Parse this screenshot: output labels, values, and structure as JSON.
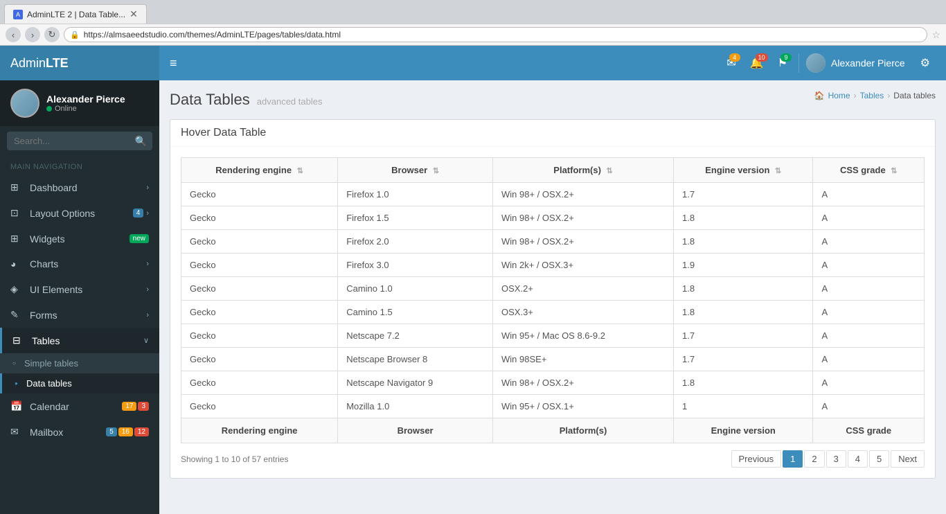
{
  "browser": {
    "tab_label": "AdminLTE 2 | Data Table...",
    "url": "https://almsaeedstudio.com/themes/AdminLTE/pages/tables/data.html",
    "favicon_text": "A"
  },
  "header": {
    "logo_light": "Admin",
    "logo_bold": "LTE",
    "toggle_icon": "≡",
    "notifications": [
      {
        "icon": "✉",
        "count": "4",
        "badge_color": "yellow"
      },
      {
        "icon": "🔔",
        "count": "10",
        "badge_color": "red"
      },
      {
        "icon": "⚑",
        "count": "9",
        "badge_color": "green"
      }
    ],
    "user_name": "Alexander Pierce",
    "gear_icon": "⚙"
  },
  "sidebar": {
    "user_name": "Alexander Pierce",
    "user_status": "Online",
    "search_placeholder": "Search...",
    "nav_label": "MAIN NAVIGATION",
    "items": [
      {
        "label": "Dashboard",
        "icon": "⊞",
        "has_arrow": true,
        "badge": null
      },
      {
        "label": "Layout Options",
        "icon": "⊡",
        "has_arrow": true,
        "badge": "4",
        "badge_color": "blue"
      },
      {
        "label": "Widgets",
        "icon": "⊞",
        "has_arrow": false,
        "badge": "new",
        "badge_color": "green"
      },
      {
        "label": "Charts",
        "icon": "◕",
        "has_arrow": true,
        "badge": null
      },
      {
        "label": "UI Elements",
        "icon": "◈",
        "has_arrow": true,
        "badge": null
      },
      {
        "label": "Forms",
        "icon": "✎",
        "has_arrow": true,
        "badge": null
      },
      {
        "label": "Tables",
        "icon": "⊟",
        "has_arrow": true,
        "badge": null,
        "active": true
      }
    ],
    "sub_items": [
      {
        "label": "Simple tables",
        "active": false
      },
      {
        "label": "Data tables",
        "active": true
      }
    ],
    "bottom_items": [
      {
        "label": "Calendar",
        "icon": "📅",
        "badge1": "17",
        "badge1_color": "orange",
        "badge2": "3",
        "badge2_color": "red"
      },
      {
        "label": "Mailbox",
        "icon": "✉",
        "badge1": "5",
        "badge1_color": "blue",
        "badge2": "16",
        "badge2_color": "orange",
        "badge3": "12",
        "badge3_color": "red"
      }
    ]
  },
  "page": {
    "title": "Data Tables",
    "subtitle": "advanced tables",
    "breadcrumb": {
      "home": "Home",
      "parent": "Tables",
      "current": "Data tables",
      "home_icon": "🏠"
    }
  },
  "table": {
    "title": "Hover Data Table",
    "columns": [
      {
        "label": "Rendering engine",
        "sort": true
      },
      {
        "label": "Browser",
        "sort": true
      },
      {
        "label": "Platform(s)",
        "sort": true
      },
      {
        "label": "Engine version",
        "sort": true
      },
      {
        "label": "CSS grade",
        "sort": true
      }
    ],
    "rows": [
      {
        "engine": "Gecko",
        "browser": "Firefox 1.0",
        "platform": "Win 98+ / OSX.2+",
        "version": "1.7",
        "grade": "A"
      },
      {
        "engine": "Gecko",
        "browser": "Firefox 1.5",
        "platform": "Win 98+ / OSX.2+",
        "version": "1.8",
        "grade": "A"
      },
      {
        "engine": "Gecko",
        "browser": "Firefox 2.0",
        "platform": "Win 98+ / OSX.2+",
        "version": "1.8",
        "grade": "A"
      },
      {
        "engine": "Gecko",
        "browser": "Firefox 3.0",
        "platform": "Win 2k+ / OSX.3+",
        "version": "1.9",
        "grade": "A"
      },
      {
        "engine": "Gecko",
        "browser": "Camino 1.0",
        "platform": "OSX.2+",
        "version": "1.8",
        "grade": "A"
      },
      {
        "engine": "Gecko",
        "browser": "Camino 1.5",
        "platform": "OSX.3+",
        "version": "1.8",
        "grade": "A"
      },
      {
        "engine": "Gecko",
        "browser": "Netscape 7.2",
        "platform": "Win 95+ / Mac OS 8.6-9.2",
        "version": "1.7",
        "grade": "A"
      },
      {
        "engine": "Gecko",
        "browser": "Netscape Browser 8",
        "platform": "Win 98SE+",
        "version": "1.7",
        "grade": "A"
      },
      {
        "engine": "Gecko",
        "browser": "Netscape Navigator 9",
        "platform": "Win 98+ / OSX.2+",
        "version": "1.8",
        "grade": "A"
      },
      {
        "engine": "Gecko",
        "browser": "Mozilla 1.0",
        "platform": "Win 95+ / OSX.1+",
        "version": "1",
        "grade": "A"
      }
    ],
    "footer_columns": [
      "Rendering engine",
      "Browser",
      "Platform(s)",
      "Engine version",
      "CSS grade"
    ],
    "info_text": "Showing 1 to 10 of 57 entries",
    "pagination": [
      "Previous",
      "1",
      "2",
      "3",
      "4",
      "5",
      "Next"
    ]
  }
}
